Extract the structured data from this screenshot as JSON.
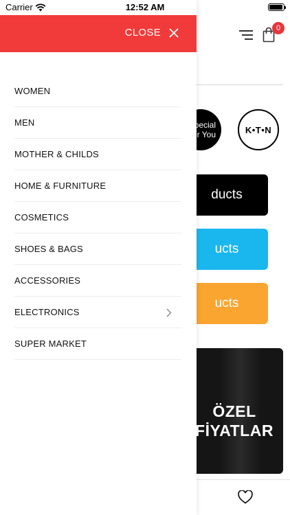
{
  "status_bar": {
    "carrier": "Carrier",
    "time": "12:52 AM"
  },
  "drawer": {
    "close_label": "CLOSE",
    "header_color": "#f13b3a",
    "menu_items": [
      {
        "label": "WOMEN",
        "has_submenu": false
      },
      {
        "label": "MEN",
        "has_submenu": false
      },
      {
        "label": "MOTHER & CHILDS",
        "has_submenu": false
      },
      {
        "label": "HOME & FURNITURE",
        "has_submenu": false
      },
      {
        "label": "COSMETICS",
        "has_submenu": false
      },
      {
        "label": "SHOES & BAGS",
        "has_submenu": false
      },
      {
        "label": "ACCESSORIES",
        "has_submenu": false
      },
      {
        "label": "ELECTRONICS",
        "has_submenu": true
      },
      {
        "label": "SUPER MARKET",
        "has_submenu": false
      }
    ]
  },
  "background_page": {
    "cart_count": "0",
    "brands": [
      {
        "line1": "pecial",
        "line2": "r You"
      },
      {
        "label": "K•T•N"
      }
    ],
    "product_buttons": [
      {
        "label": "ducts",
        "color": "#000000"
      },
      {
        "label": "ucts",
        "color": "#1ab7ee"
      },
      {
        "label": "ucts",
        "color": "#faa530"
      }
    ],
    "promo": {
      "line1": "ÖZEL",
      "line2": "FİYATLAR"
    }
  }
}
